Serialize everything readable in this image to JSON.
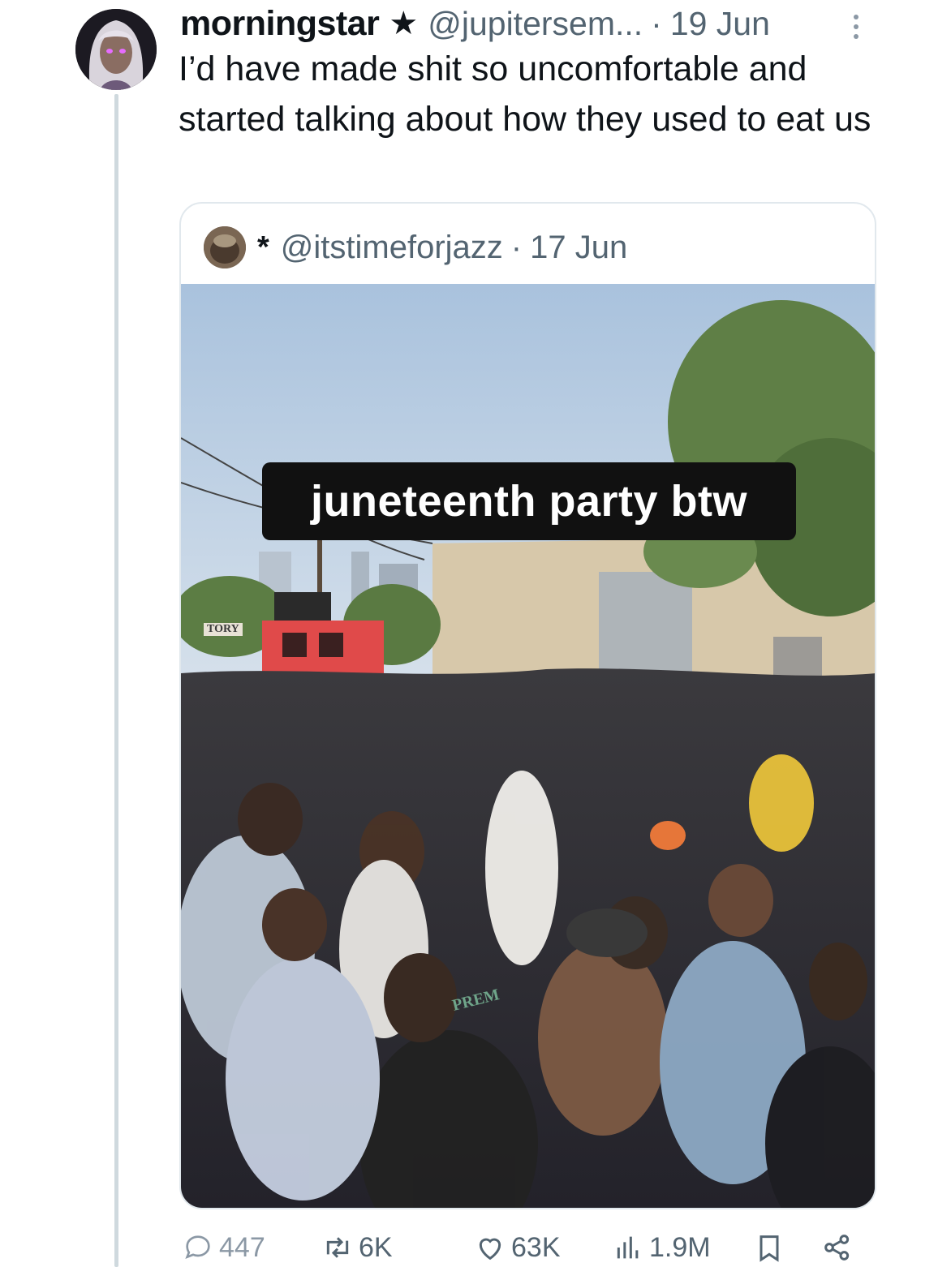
{
  "tweet": {
    "display_name": "morningstar",
    "badge_icon": "star-icon",
    "handle": "@jupitersem...",
    "separator": "·",
    "date": "19 Jun",
    "text": "I’d have made shit so uncomfortable and started talking about how they used to eat us"
  },
  "quote": {
    "name": "*",
    "handle": "@itstimeforjazz",
    "separator": "·",
    "date": "17 Jun",
    "video_caption": "juneteenth party btw",
    "sign_text": "TORY",
    "shirt_text": "PREM"
  },
  "actions": {
    "replies": "447",
    "reposts": "6K",
    "likes": "63K",
    "views": "1.9M"
  },
  "colors": {
    "text_primary": "#0f1419",
    "text_secondary": "#536471",
    "border": "#e1e8ed",
    "thread_line": "#cfd9de"
  }
}
